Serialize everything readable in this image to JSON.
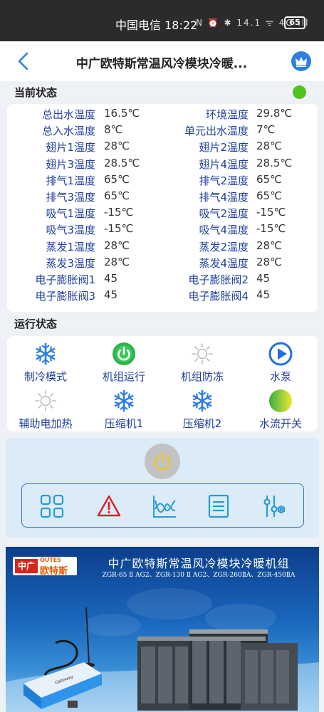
{
  "status_bar": {
    "carrier_time": "中国电信 18:22",
    "icons_text": "N ⏰ ✱ 14.1 ᯤ 4G ıll",
    "battery": "65"
  },
  "header": {
    "title": "中广欧特斯常温风冷模块冷暖..."
  },
  "current_status": {
    "title": "当前状态",
    "indicator_color": "#52c21d",
    "rows": [
      {
        "label1": "总出水温度",
        "value1": "16.5℃",
        "label2": "环境温度",
        "value2": "29.8℃"
      },
      {
        "label1": "总入水温度",
        "value1": "8℃",
        "label2": "单元出水温度",
        "value2": "7℃"
      },
      {
        "label1": "翅片1温度",
        "value1": "28℃",
        "label2": "翅片2温度",
        "value2": "28℃"
      },
      {
        "label1": "翅片3温度",
        "value1": "28.5℃",
        "label2": "翅片4温度",
        "value2": "28.5℃"
      },
      {
        "label1": "排气1温度",
        "value1": "65℃",
        "label2": "排气2温度",
        "value2": "65℃"
      },
      {
        "label1": "排气3温度",
        "value1": "65℃",
        "label2": "排气4温度",
        "value2": "65℃"
      },
      {
        "label1": "吸气1温度",
        "value1": "-15℃",
        "label2": "吸气2温度",
        "value2": "-15℃"
      },
      {
        "label1": "吸气3温度",
        "value1": "-15℃",
        "label2": "吸气4温度",
        "value2": "-15℃"
      },
      {
        "label1": "蒸发1温度",
        "value1": "28℃",
        "label2": "蒸发2温度",
        "value2": "28℃"
      },
      {
        "label1": "蒸发3温度",
        "value1": "28℃",
        "label2": "蒸发4温度",
        "value2": "28℃"
      },
      {
        "label1": "电子膨胀阀1",
        "value1": "45",
        "label2": "电子膨胀阀2",
        "value2": "45"
      },
      {
        "label1": "电子膨胀阀3",
        "value1": "45",
        "label2": "电子膨胀阀4",
        "value2": "45"
      }
    ]
  },
  "run_status": {
    "title": "运行状态",
    "items": [
      {
        "label": "制冷模式",
        "icon": "snowflake-icon",
        "color": "#2f7ee0"
      },
      {
        "label": "机组运行",
        "icon": "power-on-icon",
        "color": "#2bb34a"
      },
      {
        "label": "机组防冻",
        "icon": "sun-icon",
        "color": "#bbbbbb"
      },
      {
        "label": "水泵",
        "icon": "play-circle-icon",
        "color": "#1f6fe0"
      },
      {
        "label": "辅助电加热",
        "icon": "sun-icon",
        "color": "#bbbbbb"
      },
      {
        "label": "压缩机1",
        "icon": "snowflake-icon",
        "color": "#2f7ee0"
      },
      {
        "label": "压缩机2",
        "icon": "snowflake-icon",
        "color": "#2f7ee0"
      },
      {
        "label": "水流开关",
        "icon": "water-flow-icon",
        "color": "#58b94a"
      }
    ]
  },
  "controls": {
    "power_color": "#f0c419",
    "tools": [
      "grid-icon",
      "warning-icon",
      "chart-icon",
      "list-icon",
      "settings-sliders-icon"
    ]
  },
  "banner": {
    "logo_red": "中广",
    "logo_brand": "OUTES",
    "logo_brand_cn": "欧特斯",
    "headline": "中广欧特斯常温风冷模块冷暖机组",
    "models": "ZGR-65 Ⅱ AG2、ZGR-130 Ⅱ AG2、ZGR-260ⅡA、ZGR-450ⅡA",
    "device_text": "Gateway"
  }
}
